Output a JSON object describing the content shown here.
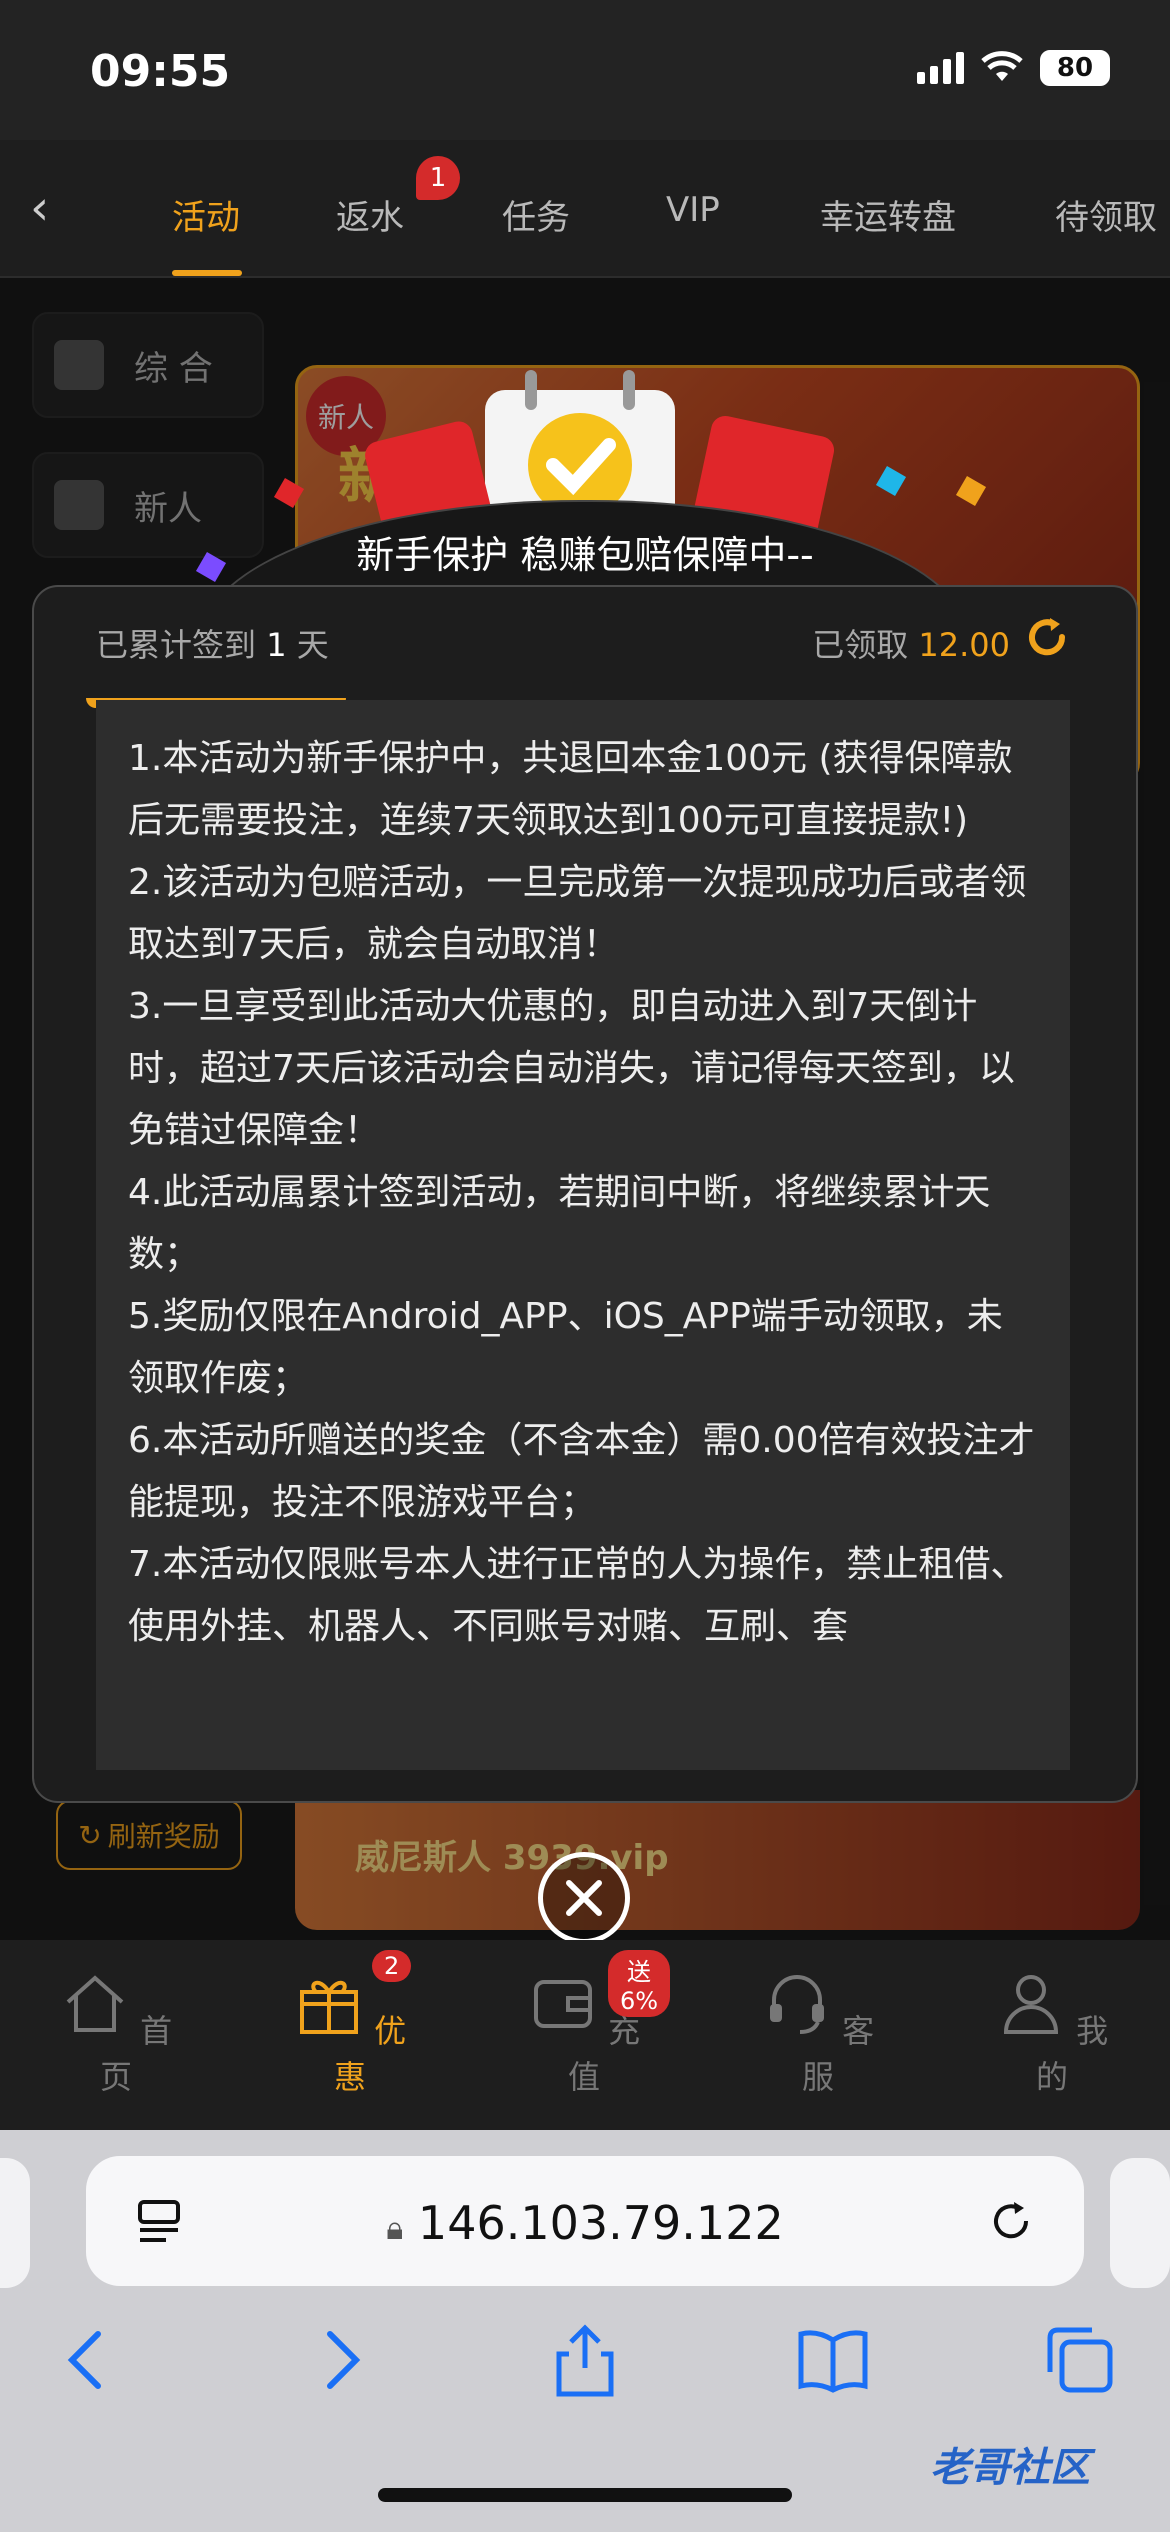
{
  "status_bar": {
    "time": "09:55",
    "battery": "80"
  },
  "tabs": {
    "items": [
      "活动",
      "返水",
      "任务",
      "VIP",
      "幸运转盘",
      "待领取"
    ],
    "active_index": 0,
    "badge": "1"
  },
  "sidebar": {
    "items": [
      "综 合",
      "新人"
    ]
  },
  "banner": {
    "tag": "新人",
    "title": "新手"
  },
  "modal": {
    "title": "新手保护 稳赚包赔保障中--",
    "stat_left_prefix": "已累计签到",
    "stat_left_value": "1",
    "stat_left_suffix": "天",
    "stat_right_label": "已领取",
    "stat_right_amount": "12.00",
    "rules": [
      "1.本活动为新手保护中，共退回本金100元 (获得保障款后无需要投注，连续7天领取达到100元可直接提款!)",
      "2.该活动为包赔活动，一旦完成第一次提现成功后或者领取达到7天后，就会自动取消！",
      "3.一旦享受到此活动大优惠的，即自动进入到7天倒计时，超过7天后该活动会自动消失，请记得每天签到，以免错过保障金！",
      "4.此活动属累计签到活动，若期间中断，将继续累计天数；",
      "5.奖励仅限在Android_APP、iOS_APP端手动领取，未领取作废；",
      "6.本活动所赠送的奖金（不含本金）需0.00倍有效投注才能提现，投注不限游戏平台；",
      "7.本活动仅限账号本人进行正常的人为操作，禁止租借、使用外挂、机器人、不同账号对赌、互刷、套"
    ]
  },
  "refresh_button": "刷新奖励",
  "bottom_banner_text": "威尼斯人 3939.vip",
  "bottom_nav": {
    "items": [
      "首页",
      "优惠",
      "充值",
      "客服",
      "我的"
    ],
    "active_index": 1,
    "promo_badge": "2",
    "deposit_badge": "送6%"
  },
  "browser": {
    "url": "146.103.79.122"
  },
  "watermark": "老哥社区",
  "colors": {
    "accent": "#f0a21c",
    "badge": "#d42b2b",
    "background": "#1b1b1b"
  }
}
